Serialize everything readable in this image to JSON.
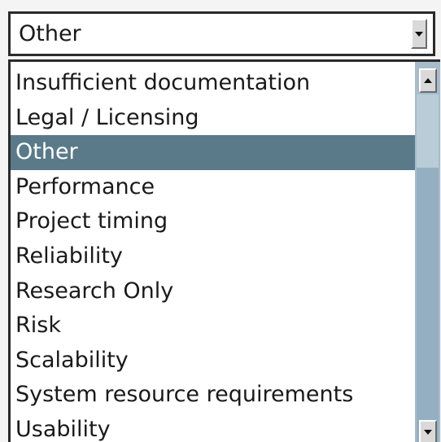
{
  "select": {
    "value": "Other",
    "arrow_icon": "triangle-down-icon"
  },
  "list": {
    "selected_index": 2,
    "items": [
      {
        "label": "Insufficient documentation"
      },
      {
        "label": "Legal / Licensing"
      },
      {
        "label": "Other"
      },
      {
        "label": "Performance"
      },
      {
        "label": "Project timing"
      },
      {
        "label": "Reliability"
      },
      {
        "label": "Research Only"
      },
      {
        "label": "Risk"
      },
      {
        "label": "Scalability"
      },
      {
        "label": "System resource requirements"
      },
      {
        "label": "Usability"
      }
    ]
  },
  "scrollbar": {
    "up_icon": "triangle-up-icon",
    "down_icon": "triangle-down-icon"
  },
  "colors": {
    "selected_background": "#5a7a8a",
    "scrollbar_track": "#a6bccb"
  }
}
